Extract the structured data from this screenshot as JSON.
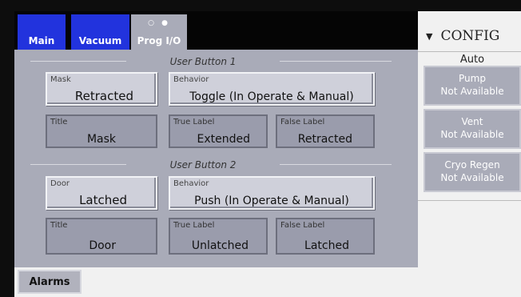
{
  "tabs": [
    {
      "label": "Main"
    },
    {
      "label": "Vacuum"
    },
    {
      "label": "Prog I/O",
      "dots": "○ ●"
    }
  ],
  "sections": [
    {
      "title": "User Button 1",
      "behavior_field": {
        "label": "Behavior",
        "value": "Toggle (In Operate & Manual)"
      },
      "state_field": {
        "label": "Mask",
        "value": "Retracted"
      },
      "title_field": {
        "label": "Title",
        "value": "Mask"
      },
      "true_field": {
        "label": "True Label",
        "value": "Extended"
      },
      "false_field": {
        "label": "False Label",
        "value": "Retracted"
      }
    },
    {
      "title": "User Button 2",
      "behavior_field": {
        "label": "Behavior",
        "value": "Push (In Operate & Manual)"
      },
      "state_field": {
        "label": "Door",
        "value": "Latched"
      },
      "title_field": {
        "label": "Title",
        "value": "Door"
      },
      "true_field": {
        "label": "True Label",
        "value": "Unlatched"
      },
      "false_field": {
        "label": "False Label",
        "value": "Latched"
      }
    }
  ],
  "footer": {
    "alarms_label": "Alarms"
  },
  "config": {
    "arrow": "▼",
    "title": "CONFIG",
    "mode": "Auto",
    "buttons": [
      {
        "name": "Pump",
        "status": "Not Available"
      },
      {
        "name": "Vent",
        "status": "Not Available"
      },
      {
        "name": "Cryo Regen",
        "status": "Not Available"
      }
    ]
  },
  "colors": {
    "tab_blue": "#2233dd",
    "panel_gray": "#a9abb8",
    "background": "#0d0d0d"
  }
}
